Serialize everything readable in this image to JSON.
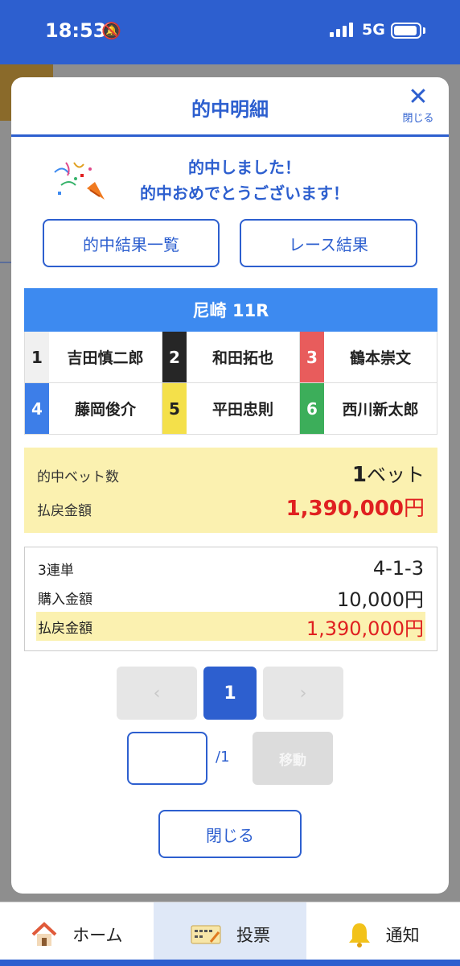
{
  "status": {
    "time": "18:53",
    "network": "5G"
  },
  "modal": {
    "title": "的中明細",
    "close_x_label": "閉じる",
    "congrats_line1": "的中しました！",
    "congrats_line2": "的中おめでとうございます！",
    "btn_hit_results": "的中結果一覧",
    "btn_race_results": "レース結果",
    "race": "尼崎 11R",
    "players": [
      {
        "num": "1",
        "name": "吉田慎二郎",
        "bg": "#f0f0f0",
        "fg": "#222222"
      },
      {
        "num": "2",
        "name": "和田拓也",
        "bg": "#262626",
        "fg": "#ffffff"
      },
      {
        "num": "3",
        "name": "鶴本崇文",
        "bg": "#e85c5c",
        "fg": "#ffffff"
      },
      {
        "num": "4",
        "name": "藤岡俊介",
        "bg": "#3d7ee8",
        "fg": "#ffffff"
      },
      {
        "num": "5",
        "name": "平田忠則",
        "bg": "#f4e04a",
        "fg": "#222222"
      },
      {
        "num": "6",
        "name": "西川新太郎",
        "bg": "#3cae5a",
        "fg": "#ffffff"
      }
    ],
    "summary": {
      "hit_bets_label": "的中ベット数",
      "hit_bets_num": "1",
      "hit_bets_unit": "ベット",
      "payout_label": "払戻金額",
      "payout_value": "1,390,000",
      "yen": "円"
    },
    "detail": {
      "bet_type": "3連単",
      "combination": "4-1-3",
      "purchase_label": "購入金額",
      "purchase_value": "10,000円",
      "payout_label": "払戻金額",
      "payout_value": "1,390,000円"
    },
    "pager": {
      "prev": "‹",
      "current": "1",
      "next": "›",
      "total": "/1",
      "move": "移動",
      "input_value": ""
    },
    "close_button": "閉じる"
  },
  "nav": {
    "home": "ホーム",
    "vote": "投票",
    "notice": "通知"
  },
  "colors": {
    "primary": "#2d5fcf",
    "race_header": "#3d8af0",
    "highlight": "#fbf1b0",
    "payout": "#e02020"
  }
}
